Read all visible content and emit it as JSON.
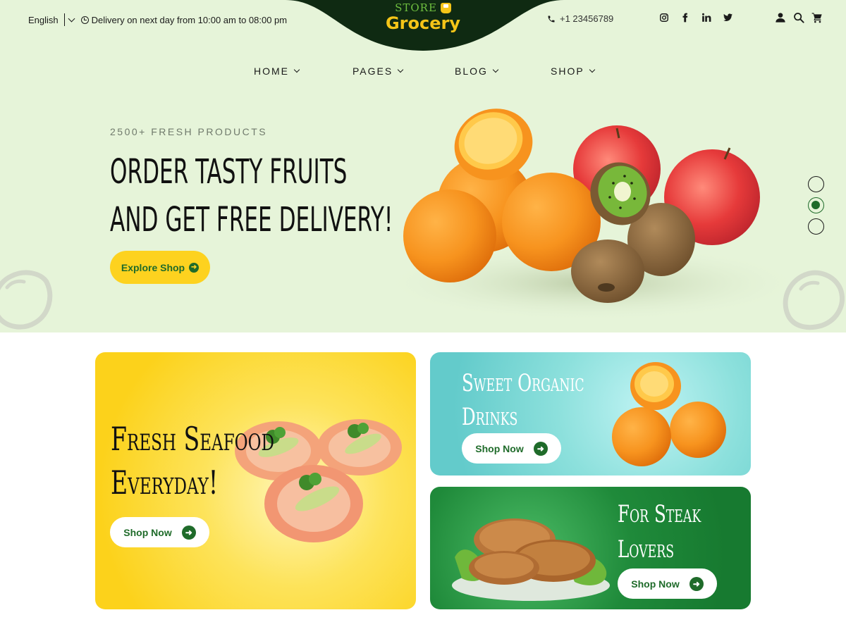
{
  "topbar": {
    "language": "English",
    "delivery_text": "Delivery on next day from 10:00 am to 08:00 pm",
    "phone": "+1 23456789"
  },
  "logo": {
    "store": "STORE",
    "name": "Grocery"
  },
  "socials": [
    "instagram-icon",
    "facebook-icon",
    "linkedin-icon",
    "twitter-icon"
  ],
  "utilities": [
    "user-icon",
    "search-icon",
    "cart-icon"
  ],
  "nav": {
    "items": [
      {
        "label": "HOME"
      },
      {
        "label": "PAGES"
      },
      {
        "label": "BLOG"
      },
      {
        "label": "SHOP"
      }
    ]
  },
  "hero": {
    "subtitle": "2500+ FRESH PRODUCTS",
    "title_line1": "Order tasty fruits",
    "title_line2": "and get free delivery!",
    "cta": "Explore Shop",
    "slider": {
      "count": 3,
      "active": 2
    }
  },
  "promos": [
    {
      "title_line1": "Fresh Seafood",
      "title_line2": "Everyday!",
      "cta": "Shop Now"
    },
    {
      "title_line1": "Sweet Organic",
      "title_line2": "Drinks",
      "cta": "Shop Now"
    },
    {
      "title_line1": "For Steak",
      "title_line2": "Lovers",
      "cta": "Shop Now"
    }
  ],
  "colors": {
    "hero_bg": "#e6f4d9",
    "brand_dark": "#0f2a12",
    "brand_green": "#1f6b2a",
    "accent_yellow": "#fdd21f",
    "seafood_bg": "#fcd21b",
    "drinks_bg": "#63cbcb",
    "steak_bg": "#177a30"
  }
}
